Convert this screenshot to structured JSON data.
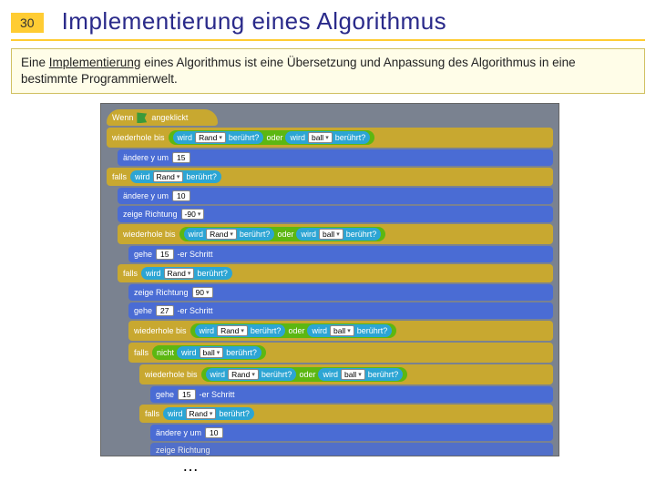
{
  "header": {
    "page_number": "30",
    "title": "Implementierung eines Algorithmus"
  },
  "intro": {
    "prefix": "Eine ",
    "keyword": "Implementierung",
    "rest": " eines Algorithmus ist eine Übersetzung und Anpassung des Algorithmus in eine bestimmte Programmierwelt."
  },
  "scratch": {
    "hat": {
      "when": "Wenn",
      "clicked": "angeklickt"
    },
    "repeat_until": "wiederhole bis",
    "touching": "wird",
    "touching2": "berührt?",
    "edge": "Rand",
    "ball": "ball",
    "or": "oder",
    "not": "nicht",
    "change_y": "ändere y um",
    "v15": "15",
    "v10": "10",
    "vneg90": "-90",
    "v90": "90",
    "v27": "27",
    "if": "falls",
    "point_dir": "zeige Richtung",
    "move": "gehe",
    "steps": "-er Schritt",
    "ellipsis": "…"
  }
}
